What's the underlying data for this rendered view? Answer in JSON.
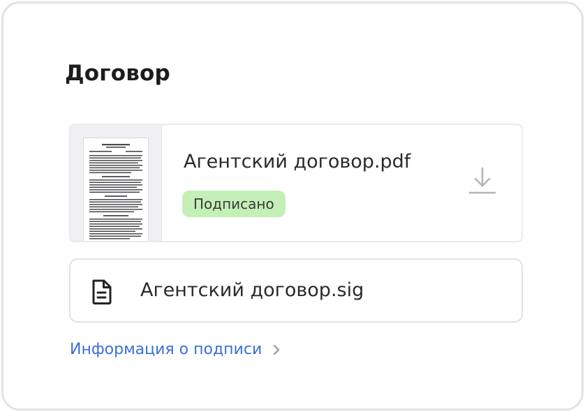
{
  "section": {
    "title": "Договор"
  },
  "document": {
    "file_name": "Агентский договор.pdf",
    "status": "Подписано",
    "status_color": "#c4efb6"
  },
  "signature_file": {
    "file_name": "Агентский договор.sig"
  },
  "signature_info_link": {
    "label": "Информация о подписи",
    "color": "#3b6fd6"
  },
  "icons": {
    "download": "download-icon",
    "file": "file-icon",
    "chevron": "chevron-right-icon"
  }
}
